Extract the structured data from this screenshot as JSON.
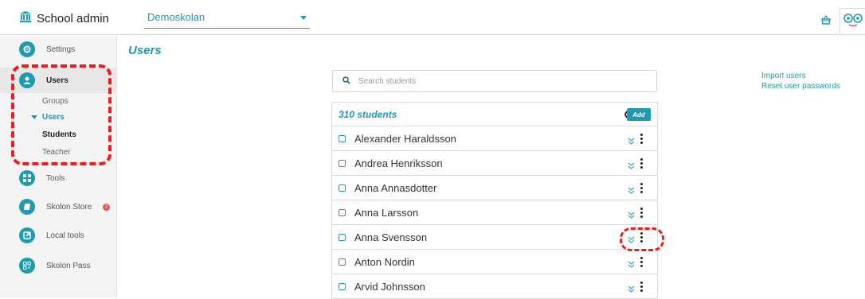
{
  "app": {
    "title": "School admin",
    "school_select": "Demoskolan"
  },
  "sidebar": {
    "items": [
      {
        "label": "Settings",
        "icon": "gear-icon"
      },
      {
        "label": "Users",
        "icon": "user-icon"
      },
      {
        "label": "Tools",
        "icon": "grid-icon"
      },
      {
        "label": "Skolon Store",
        "icon": "book-icon",
        "badge": "2"
      },
      {
        "label": "Local tools",
        "icon": "external-link-icon"
      },
      {
        "label": "Skolon Pass",
        "icon": "qr-code-icon"
      }
    ],
    "subitems": {
      "groups": "Groups",
      "users": "Users",
      "students": "Students",
      "teacher": "Teacher"
    }
  },
  "main": {
    "page_title": "Users",
    "search_placeholder": "Search students",
    "links": {
      "import": "Import users",
      "reset": "Reset user passwords"
    },
    "list": {
      "count": "310 students",
      "add_label": "Add",
      "rows": [
        "Alexander Haraldsson",
        "Andrea Henriksson",
        "Anna Annasdotter",
        "Anna Larsson",
        "Anna Svensson",
        "Anton Nordin",
        "Arvid Johnsson"
      ]
    }
  },
  "colors": {
    "accent": "#1e9bb0",
    "annotation": "#f21b1b",
    "badge": "#e85050"
  }
}
